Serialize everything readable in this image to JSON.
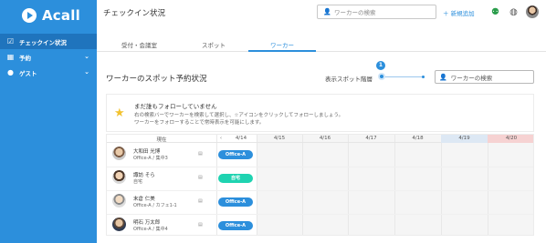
{
  "brand": {
    "name": "Acall",
    "logo_icon": "play-circle-icon"
  },
  "sidebar": {
    "items": [
      {
        "label": "チェックイン状況",
        "icon": "checkbox-icon",
        "active": true
      },
      {
        "label": "予約",
        "icon": "calendar-icon",
        "chevron": "chevron-down-icon"
      },
      {
        "label": "ゲスト",
        "icon": "person-icon",
        "chevron": "chevron-down-icon"
      }
    ]
  },
  "header": {
    "title": "チェックイン状況",
    "search_placeholder": "ワーカーの検索",
    "add_label": "＋ 新規追加",
    "icons": [
      "status-person-icon",
      "globe-icon",
      "user-avatar"
    ]
  },
  "tabs": [
    {
      "label": "受付・会議室"
    },
    {
      "label": "スポット"
    },
    {
      "label": "ワーカー",
      "active": true
    }
  ],
  "section": {
    "title": "ワーカーのスポット予約状況",
    "spot_level_label": "表示スポット階層",
    "spot_level_value": "1",
    "worker_search_placeholder": "ワーカーの検索"
  },
  "notice": {
    "title": "まだ誰もフォローしていません",
    "line1": "右の検索バーでワーカーを検索して選択し、☆アイコンをクリックしてフォローしましょう。",
    "line2": "ワーカーをフォローすることで常時表示を可能にします。"
  },
  "table": {
    "header_label": "現在",
    "prev_arrow": "‹",
    "dates": [
      {
        "label": "4/14"
      },
      {
        "label": "4/15"
      },
      {
        "label": "4/16"
      },
      {
        "label": "4/17"
      },
      {
        "label": "4/18"
      },
      {
        "label": "4/19",
        "color": "#dde8f4"
      },
      {
        "label": "4/20",
        "color": "#f6d2d2"
      }
    ],
    "rows": [
      {
        "name": "大和田 光博",
        "location": "Office-A / 集中3",
        "status": "Office-A",
        "status_type": "office",
        "avatar_color": "#7a5a43"
      },
      {
        "name": "諏訪 そら",
        "location": "自宅",
        "status": "自宅",
        "status_type": "home",
        "avatar_color": "#4a3528"
      },
      {
        "name": "末倉 仁美",
        "location": "Office-A / カフェ1-1",
        "status": "Office-A",
        "status_type": "office",
        "avatar_color": "#8a8a8a"
      },
      {
        "name": "明石 万太郎",
        "location": "Office-A / 集中4",
        "status": "Office-A",
        "status_type": "office",
        "avatar_color": "#5a4638"
      }
    ],
    "row_icon": "id-card-icon"
  }
}
